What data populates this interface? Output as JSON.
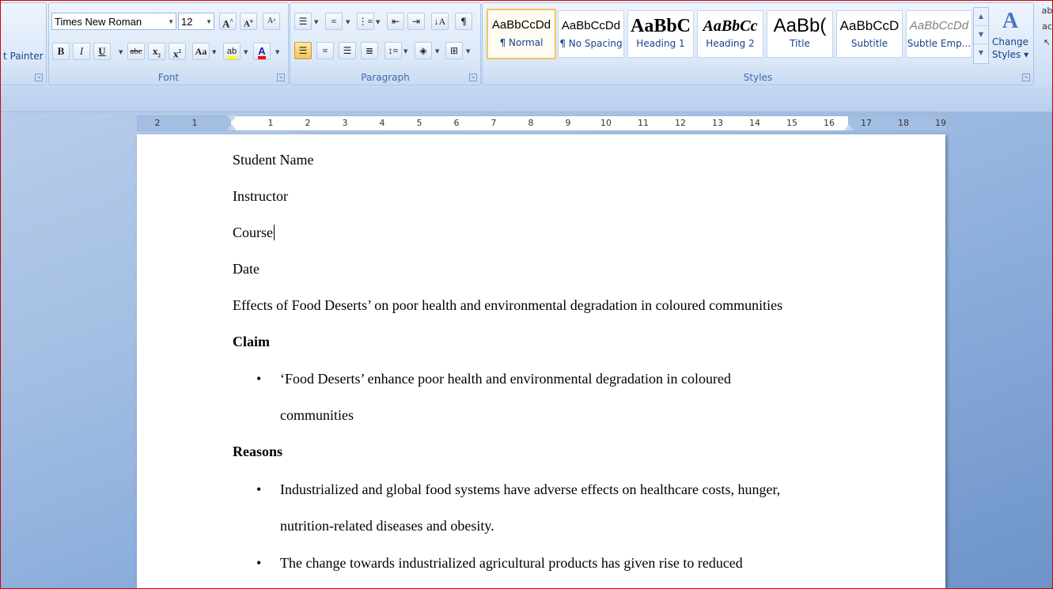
{
  "clipboard": {
    "format_painter_label": "t Painter"
  },
  "font_group": {
    "label": "Font",
    "font_name": "Times New Roman",
    "font_size": "12",
    "grow_label": "A",
    "shrink_label": "A",
    "bold_label": "B",
    "italic_label": "I",
    "underline_label": "U",
    "strike_label": "abc",
    "subscript_label": "x",
    "superscript_label": "x",
    "case_label": "Aa",
    "highlight_label": "ab",
    "font_color_label": "A",
    "highlight_color": "#ffff00",
    "font_color": "#ff0000"
  },
  "paragraph_group": {
    "label": "Paragraph",
    "pilcrow_label": "¶"
  },
  "styles_group": {
    "label": "Styles",
    "tiles": [
      {
        "sample": "AaBbCcDd",
        "name": "¶ Normal"
      },
      {
        "sample": "AaBbCcDd",
        "name": "¶ No Spacing"
      },
      {
        "sample": "AaBbC",
        "name": "Heading 1"
      },
      {
        "sample": "AaBbCc",
        "name": "Heading 2"
      },
      {
        "sample": "AaBb(",
        "name": "Title"
      },
      {
        "sample": "AaBbCcD",
        "name": "Subtitle"
      },
      {
        "sample": "AaBbCcDd",
        "name": "Subtle Emp..."
      }
    ],
    "change_styles_label_1": "Change",
    "change_styles_label_2": "Styles"
  },
  "ruler": {
    "labels": [
      "2",
      "1",
      "1",
      "2",
      "3",
      "4",
      "5",
      "6",
      "7",
      "8",
      "9",
      "10",
      "11",
      "12",
      "13",
      "14",
      "15",
      "16",
      "17",
      "18",
      "19"
    ]
  },
  "document": {
    "lines": [
      "Student Name",
      "Instructor",
      "Course",
      "Date",
      "Effects of Food Deserts’ on poor health and environmental degradation in coloured communities"
    ],
    "claim_heading": "Claim",
    "claim_bullets": [
      "‘Food Deserts’ enhance poor health and environmental degradation in coloured",
      "communities"
    ],
    "reasons_heading": "Reasons",
    "reason_bullets": [
      "Industrialized and global food systems have adverse effects on healthcare costs, hunger,",
      "nutrition-related diseases and obesity.",
      "The change towards industrialized agricultural products has given rise to reduced"
    ]
  }
}
